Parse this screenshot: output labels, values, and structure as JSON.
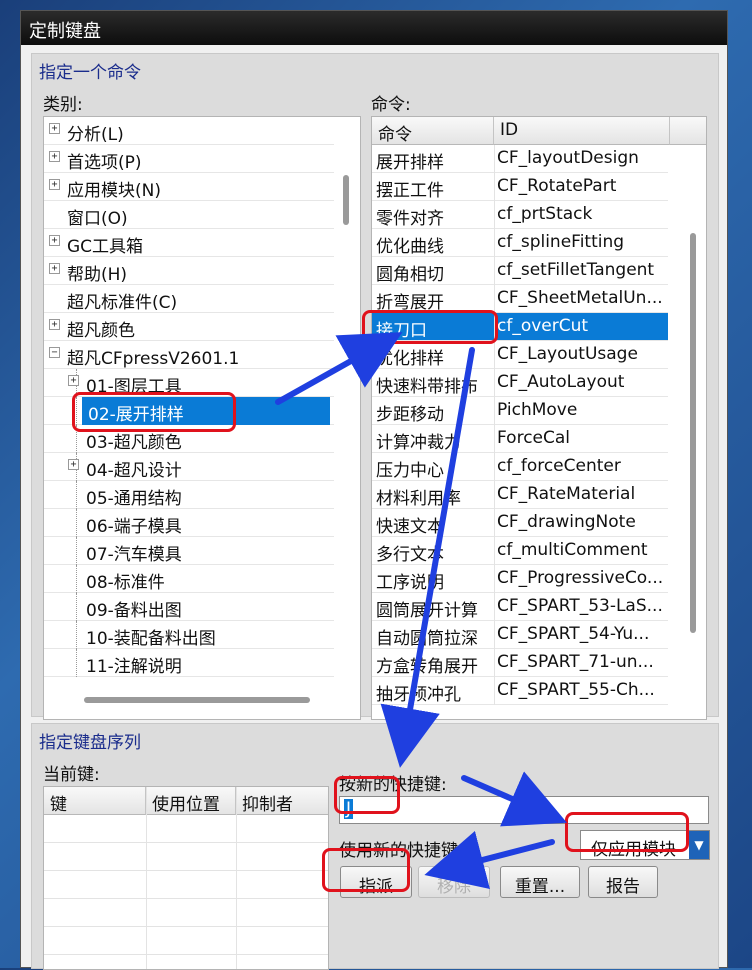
{
  "window": {
    "title": "定制键盘"
  },
  "section1": {
    "title": "指定一个命令",
    "category_label": "类别:",
    "command_label": "命令:"
  },
  "categories": [
    {
      "label": "分析(L)",
      "expander": "+"
    },
    {
      "label": "首选项(P)",
      "expander": "+"
    },
    {
      "label": "应用模块(N)",
      "expander": "+"
    },
    {
      "label": "窗口(O)",
      "expander": ""
    },
    {
      "label": "GC工具箱",
      "expander": "+"
    },
    {
      "label": "帮助(H)",
      "expander": "+"
    },
    {
      "label": "超凡标准件(C)",
      "expander": ""
    },
    {
      "label": "超凡颜色",
      "expander": "+"
    },
    {
      "label": "超凡CFpressV2601.1",
      "expander": "−"
    },
    {
      "label": "01-图层工具",
      "expander": "+"
    },
    {
      "label": "02-展开排样",
      "expander": "",
      "selected": true
    },
    {
      "label": "03-超凡颜色",
      "expander": ""
    },
    {
      "label": "04-超凡设计",
      "expander": "+"
    },
    {
      "label": "05-通用结构",
      "expander": ""
    },
    {
      "label": "06-端子模具",
      "expander": ""
    },
    {
      "label": "07-汽车模具",
      "expander": ""
    },
    {
      "label": "08-标准件",
      "expander": ""
    },
    {
      "label": "09-备料出图",
      "expander": ""
    },
    {
      "label": "10-装配备料出图",
      "expander": ""
    },
    {
      "label": "11-注解说明",
      "expander": ""
    }
  ],
  "commands": {
    "headers": [
      "命令",
      "ID"
    ],
    "rows": [
      [
        "展开排样",
        "CF_layoutDesign"
      ],
      [
        "摆正工件",
        "CF_RotatePart"
      ],
      [
        "零件对齐",
        "cf_prtStack"
      ],
      [
        "优化曲线",
        "cf_splineFitting"
      ],
      [
        "圆角相切",
        "cf_setFilletTangent"
      ],
      [
        "折弯展开",
        "CF_SheetMetalUn..."
      ],
      [
        "接刀口",
        "cf_overCut"
      ],
      [
        "优化排样",
        "CF_LayoutUsage"
      ],
      [
        "快速料带排布",
        "CF_AutoLayout"
      ],
      [
        "步距移动",
        "PichMove"
      ],
      [
        "计算冲裁力",
        "ForceCal"
      ],
      [
        "压力中心",
        "cf_forceCenter"
      ],
      [
        "材料利用率",
        "CF_RateMaterial"
      ],
      [
        "快速文本",
        "CF_drawingNote"
      ],
      [
        "多行文本",
        "cf_multiComment"
      ],
      [
        "工序说明",
        "CF_ProgressiveCo..."
      ],
      [
        "圆筒展开计算",
        "CF_SPART_53-LaS..."
      ],
      [
        "自动圆筒拉深",
        "CF_SPART_54-Yu..."
      ],
      [
        "方盒转角展开",
        "CF_SPART_71-un..."
      ],
      [
        "抽牙预冲孔",
        "CF_SPART_55-Ch..."
      ]
    ],
    "selected_index": 6
  },
  "section2": {
    "title": "指定键盘序列",
    "current_keys_label": "当前键:",
    "key_headers": [
      "键",
      "使用位置",
      "抑制者"
    ],
    "new_shortcut_label": "按新的快捷键:",
    "new_shortcut_value": "J",
    "use_new_label": "使用新的快捷键:",
    "scope_value": "仅应用模块",
    "buttons": {
      "assign": "指派",
      "remove": "移除",
      "reset": "重置...",
      "report": "报告"
    }
  },
  "colors": {
    "selection": "#0a7bd6",
    "annotation_red": "#e0121c",
    "annotation_arrow": "#1f3fe0"
  }
}
